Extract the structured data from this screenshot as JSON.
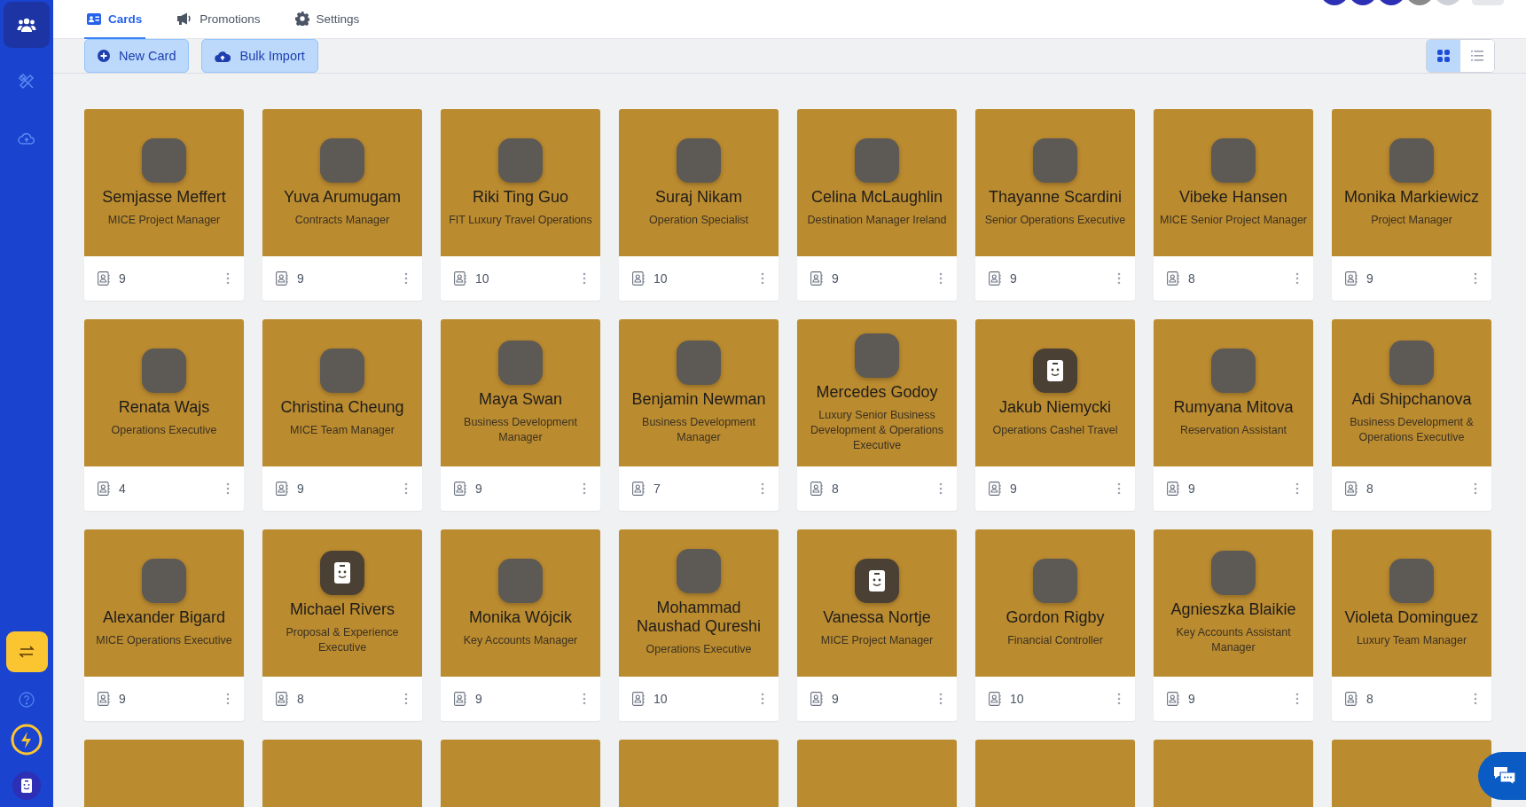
{
  "sidebar": {
    "items": [
      {
        "kind": "team",
        "selected": true
      },
      {
        "kind": "tools",
        "selected": false
      },
      {
        "kind": "upload",
        "selected": false
      }
    ],
    "bottom": [
      {
        "kind": "switch"
      },
      {
        "kind": "help"
      },
      {
        "kind": "bolt"
      },
      {
        "kind": "badge"
      }
    ]
  },
  "tabs": [
    {
      "label": "Cards",
      "selected": true
    },
    {
      "label": "Promotions",
      "selected": false
    },
    {
      "label": "Settings",
      "selected": false
    }
  ],
  "toolbar": {
    "buttons": [
      {
        "label": "New Card"
      },
      {
        "label": "Bulk Import"
      }
    ],
    "views": [
      {
        "kind": "grid",
        "selected": true
      },
      {
        "kind": "list",
        "selected": false
      }
    ]
  },
  "cards": [
    {
      "name": "Semjasse Meffert",
      "title": "MICE Project Manager",
      "count": "9",
      "kind": "photo"
    },
    {
      "name": "Yuva Arumugam",
      "title": "Contracts Manager",
      "count": "9",
      "kind": "photo"
    },
    {
      "name": "Riki Ting Guo",
      "title": "FIT Luxury Travel Operations",
      "count": "10",
      "kind": "photo"
    },
    {
      "name": "Suraj Nikam",
      "title": "Operation Specialist",
      "count": "10",
      "kind": "photo"
    },
    {
      "name": "Celina McLaughlin",
      "title": "Destination Manager Ireland",
      "count": "9",
      "kind": "photo"
    },
    {
      "name": "Thayanne Scardini",
      "title": "Senior Operations Executive",
      "count": "9",
      "kind": "photo"
    },
    {
      "name": "Vibeke Hansen",
      "title": "MICE Senior Project Manager",
      "count": "8",
      "kind": "photo"
    },
    {
      "name": "Monika Markiewicz",
      "title": "Project Manager",
      "count": "9",
      "kind": "photo"
    },
    {
      "name": "Renata Wajs",
      "title": "Operations Executive",
      "count": "4",
      "kind": "photo"
    },
    {
      "name": "Christina Cheung",
      "title": "MICE Team Manager",
      "count": "9",
      "kind": "photo"
    },
    {
      "name": "Maya Swan",
      "title": "Business Development Manager",
      "count": "9",
      "kind": "photo"
    },
    {
      "name": "Benjamin Newman",
      "title": "Business Development Manager",
      "count": "7",
      "kind": "photo"
    },
    {
      "name": "Mercedes Godoy",
      "title": "Luxury Senior Business Development & Operations Executive",
      "count": "8",
      "kind": "photo"
    },
    {
      "name": "Jakub Niemycki",
      "title": "Operations Cashel Travel",
      "count": "9",
      "kind": "placeholder"
    },
    {
      "name": "Rumyana Mitova",
      "title": "Reservation Assistant",
      "count": "9",
      "kind": "photo"
    },
    {
      "name": "Adi Shipchanova",
      "title": "Business Development & Operations Executive",
      "count": "8",
      "kind": "photo"
    },
    {
      "name": "Alexander Bigard",
      "title": "MICE Operations Executive",
      "count": "9",
      "kind": "photo"
    },
    {
      "name": "Michael Rivers",
      "title": "Proposal & Experience Executive",
      "count": "8",
      "kind": "placeholder"
    },
    {
      "name": "Monika Wójcik",
      "title": "Key Accounts Manager",
      "count": "9",
      "kind": "photo"
    },
    {
      "name": "Mohammad Naushad Qureshi",
      "title": "Operations Executive",
      "count": "10",
      "kind": "photo"
    },
    {
      "name": "Vanessa Nortje",
      "title": "MICE Project Manager",
      "count": "9",
      "kind": "placeholder"
    },
    {
      "name": "Gordon Rigby",
      "title": "Financial Controller",
      "count": "10",
      "kind": "photo"
    },
    {
      "name": "Agnieszka Blaikie",
      "title": "Key Accounts Assistant Manager",
      "count": "9",
      "kind": "photo"
    },
    {
      "name": "Violeta Dominguez",
      "title": "Luxury Team Manager",
      "count": "8",
      "kind": "photo"
    },
    {
      "kind": "cut"
    },
    {
      "kind": "cut"
    },
    {
      "kind": "cut"
    },
    {
      "kind": "cut"
    },
    {
      "kind": "cut"
    },
    {
      "kind": "cut"
    },
    {
      "kind": "cut"
    },
    {
      "kind": "cut"
    }
  ]
}
